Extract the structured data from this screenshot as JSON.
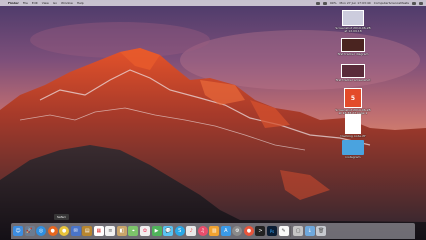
{
  "menubar": {
    "app_name": "Finder",
    "items": [
      "File",
      "Edit",
      "View",
      "Go",
      "Window",
      "Help"
    ],
    "clock": "Mon 27 Jun 17:03:40",
    "user": "ComputerScienceMasts",
    "battery": "99%"
  },
  "desktop_items": [
    {
      "label": "Screenshot 2019-06-28 at 12.09.18",
      "thumb_color": "#9aa6b5",
      "icon": "screenshot-icon"
    },
    {
      "label": "first tracker diagram",
      "thumb_color": "#4a2420",
      "icon": "image-icon"
    },
    {
      "label": "first tracker screenshot",
      "thumb_color": "#5a2b3a",
      "icon": "image-icon"
    },
    {
      "label": "Screenshot 2019-06-28 at 16.38.27 page 1 Video text",
      "thumb_color": "#e34b2a",
      "icon": "html5-icon"
    },
    {
      "label": "tracking code.rtf",
      "thumb_color": "#ffffff",
      "icon": "document-icon"
    },
    {
      "label": "instagram",
      "thumb_color": "#4aa3df",
      "icon": "folder-icon"
    }
  ],
  "dock": {
    "tooltip": "Safari",
    "apps": [
      {
        "name": "finder",
        "color": "#3d8de0",
        "glyph": "☺"
      },
      {
        "name": "launchpad",
        "color": "#6c7b8f",
        "glyph": "🚀"
      },
      {
        "name": "safari",
        "color": "#2f8fe0",
        "glyph": "◎"
      },
      {
        "name": "firefox",
        "color": "#e8661f",
        "glyph": "●"
      },
      {
        "name": "chrome",
        "color": "#e9c33b",
        "glyph": "●"
      },
      {
        "name": "mail",
        "color": "#4a74c9",
        "glyph": "✉"
      },
      {
        "name": "notes",
        "color": "#b8862f",
        "glyph": "▤"
      },
      {
        "name": "calendar",
        "color": "#ffffff",
        "glyph": "▦"
      },
      {
        "name": "reminders",
        "color": "#f2f2f2",
        "glyph": "≡"
      },
      {
        "name": "contacts",
        "color": "#c9a56a",
        "glyph": "◧"
      },
      {
        "name": "maps",
        "color": "#7cc46a",
        "glyph": "⌖"
      },
      {
        "name": "photos",
        "color": "#f0f0f0",
        "glyph": "✿"
      },
      {
        "name": "facetime",
        "color": "#4fb35a",
        "glyph": "▶"
      },
      {
        "name": "messages",
        "color": "#5ac4f2",
        "glyph": "💬"
      },
      {
        "name": "skype",
        "color": "#2aa8e6",
        "glyph": "S"
      },
      {
        "name": "music",
        "color": "#e9e9e9",
        "glyph": "♪"
      },
      {
        "name": "itunes",
        "color": "#e94d6b",
        "glyph": "♫"
      },
      {
        "name": "books",
        "color": "#f0a230",
        "glyph": "▥"
      },
      {
        "name": "app-store",
        "color": "#3a9ae8",
        "glyph": "A"
      },
      {
        "name": "system-preferences",
        "color": "#8a8a8a",
        "glyph": "⚙"
      },
      {
        "name": "chrome-2",
        "color": "#e9553b",
        "glyph": "●"
      },
      {
        "name": "terminal",
        "color": "#222222",
        "glyph": ">"
      },
      {
        "name": "photoshop",
        "color": "#0b1d33",
        "glyph": "Ps"
      },
      {
        "name": "textedit",
        "color": "#fafafa",
        "glyph": "✎"
      },
      {
        "name": "preview",
        "color": "#c5c5c5",
        "glyph": "▢"
      },
      {
        "name": "downloads",
        "color": "#6fa8dc",
        "glyph": "↓"
      },
      {
        "name": "trash",
        "color": "#c7cad0",
        "glyph": "🗑"
      }
    ]
  }
}
